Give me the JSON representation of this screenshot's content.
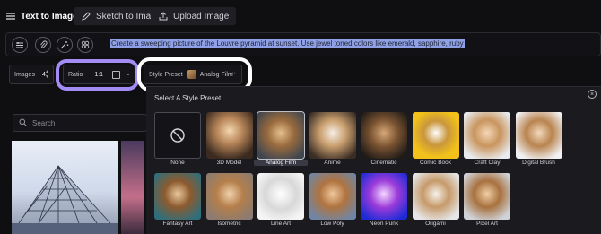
{
  "tabs": {
    "text_to_image": "Text to Image",
    "sketch_to_image": "Sketch to Image",
    "upload_image": "Upload Image"
  },
  "prompt": {
    "text": "Create a sweeping picture of the Louvre pyramid at sunset.  Use jewel toned colors like emerald, sapphire, ruby",
    "tools": [
      "settings-sliders-icon",
      "paperclip-icon",
      "magic-wand-icon",
      "shapes-icon"
    ]
  },
  "controls": {
    "images_label": "Images",
    "images_value": "4",
    "ratio_label": "Ratio",
    "ratio_value": "1:1",
    "style_label": "Style Preset",
    "style_value": "Analog Film",
    "more": "···"
  },
  "search": {
    "placeholder": "Search"
  },
  "panel": {
    "title": "Select A Style Preset",
    "close": "×",
    "selected": "Analog Film",
    "presets_row1": [
      "None",
      "3D Model",
      "Analog Film",
      "Anime",
      "Cinematic",
      "Comic Book",
      "Craft Clay",
      "Digital Brush"
    ],
    "presets_row2": [
      "Fantasy Art",
      "Isometric",
      "Line Art",
      "Low Poly",
      "Neon Punk",
      "Origami",
      "Pixel Art"
    ]
  },
  "colors": {
    "accent_ring_ratio": "#a48cf5",
    "accent_ring_style": "#ffffff",
    "prompt_highlight": "#8fa0e6",
    "background": "#0f0f12",
    "panel_background": "#1a1a1f"
  }
}
